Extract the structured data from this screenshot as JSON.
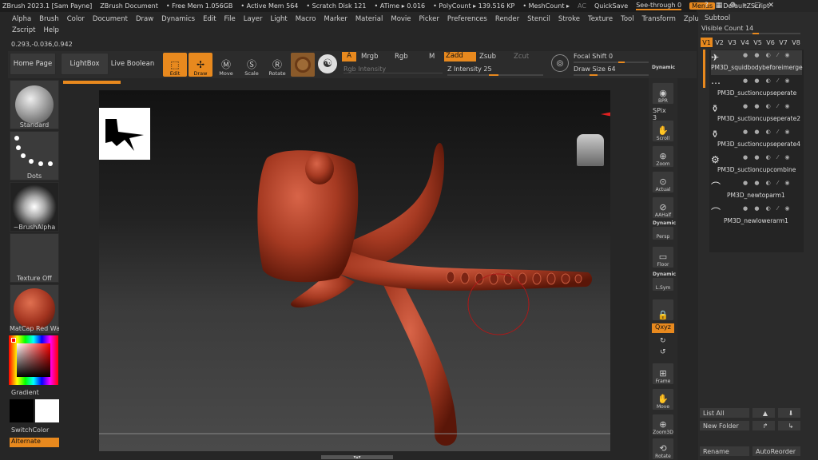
{
  "titlebar": {
    "app": "ZBrush 2023.1 [Sam Payne]",
    "doc": "ZBrush Document",
    "free_mem": "• Free Mem 1.056GB",
    "active_mem": "• Active Mem 564",
    "scratch": "• Scratch Disk 121",
    "atime": "• ATime ▸ 0.016",
    "polycount": "• PolyCount ▸ 139.516 KP",
    "meshcount": "• MeshCount ▸",
    "ac": "AC",
    "quicksave": "QuickSave",
    "seethrough": "See-through  0",
    "menus": "Menus",
    "script": "DefaultZScript"
  },
  "menu": [
    "Alpha",
    "Brush",
    "Color",
    "Document",
    "Draw",
    "Dynamics",
    "Edit",
    "File",
    "Layer",
    "Light",
    "Macro",
    "Marker",
    "Material",
    "Movie",
    "Picker",
    "Preferences",
    "Render",
    "Stencil",
    "Stroke",
    "Texture",
    "Tool",
    "Transform",
    "Zplugin"
  ],
  "menu2": [
    "Zscript",
    "Help"
  ],
  "coords": "0.293,-0.036,0.942",
  "toolbar": {
    "home": "Home Page",
    "lightbox": "LightBox",
    "liveboolean": "Live Boolean",
    "edit": "Edit",
    "draw": "Draw",
    "move": "Move",
    "scale": "Scale",
    "rotate": "Rotate",
    "a": "A",
    "mrgb": "Mrgb",
    "rgb": "Rgb",
    "m": "M",
    "zadd": "Zadd",
    "zsub": "Zsub",
    "zcut": "Zcut",
    "rgb_intensity": "Rgb Intensity",
    "z_intensity": "Z Intensity 25",
    "focal_shift": "Focal Shift 0",
    "draw_size": "Draw Size 64",
    "dynamic": "Dynamic"
  },
  "shelf": {
    "standard": "Standard",
    "dots": "Dots",
    "brushalpha": "~BrushAlpha",
    "texture": "Texture Off",
    "matcap": "MatCap Red Wax",
    "gradient": "Gradient",
    "switchcolor": "SwitchColor",
    "alternate": "Alternate"
  },
  "rightshelf": {
    "bpr": "BPR",
    "spix": "SPix 3",
    "scroll": "Scroll",
    "zoom": "Zoom",
    "actual": "Actual",
    "aahalf": "AAHalf",
    "dynamic_persp": "Dynamic",
    "persp": "Persp",
    "floor": "Floor",
    "dynamic_lsym": "Dynamic",
    "lsym": "L.Sym",
    "qxyz": "Qxyz",
    "frame": "Frame",
    "move": "Move",
    "zoom3d": "Zoom3D",
    "rotate": "Rotate"
  },
  "subtool": {
    "title": "Subtool",
    "visible_count": "Visible Count 14",
    "tabs": [
      "V1",
      "V2",
      "V3",
      "V4",
      "V5",
      "V6",
      "V7",
      "V8"
    ],
    "items": [
      {
        "name": "PM3D_squidbodybeforeimerge"
      },
      {
        "name": "PM3D_suctioncupseperate"
      },
      {
        "name": "PM3D_suctioncupseperate2"
      },
      {
        "name": "PM3D_suctioncupseperate4"
      },
      {
        "name": "PM3D_suctioncupcombine"
      },
      {
        "name": "PM3D_newtoparm1"
      },
      {
        "name": "PM3D_newlowerarm1"
      }
    ],
    "list_all": "List All",
    "new_folder": "New Folder",
    "rename": "Rename",
    "autoreorder": "AutoReorder"
  },
  "colors": {
    "accent": "#e8891e",
    "model": "#b5432a"
  }
}
